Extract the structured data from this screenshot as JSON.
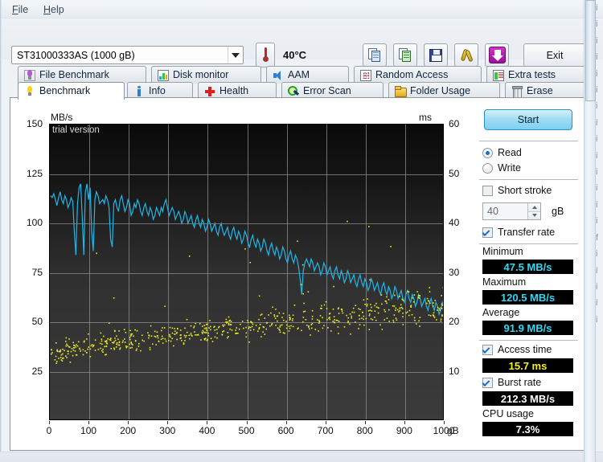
{
  "window": {
    "menu": [
      {
        "name": "file",
        "label": "File",
        "mnemonic": "F"
      },
      {
        "name": "help",
        "label": "Help",
        "mnemonic": "H"
      }
    ]
  },
  "toolbar": {
    "drive_select": {
      "value": "ST31000333AS (1000 gB)",
      "options": [
        "ST31000333AS (1000 gB)"
      ]
    },
    "temperature": "40°C",
    "temperature_icon": "thermometer-icon",
    "buttons": [
      {
        "name": "copy-to-clipboard-button",
        "icon": "copy-page-icon",
        "label": ""
      },
      {
        "name": "copy-image-button",
        "icon": "copy-image-icon",
        "label": ""
      },
      {
        "name": "save-button",
        "icon": "floppy-save-icon",
        "label": ""
      },
      {
        "name": "options-button",
        "icon": "tools-icon",
        "label": ""
      },
      {
        "name": "download-button",
        "icon": "download-arrow-icon",
        "label": ""
      }
    ],
    "exit_label": "Exit"
  },
  "tabs": {
    "row1": [
      {
        "label": "File Benchmark",
        "icon": "bulb-purple-icon",
        "active": false
      },
      {
        "label": "Disk monitor",
        "icon": "bar-chart-icon",
        "active": false
      },
      {
        "label": "AAM",
        "icon": "speaker-icon",
        "active": false
      },
      {
        "label": "Random Access",
        "icon": "scatter-plot-icon",
        "active": false
      },
      {
        "label": "Extra tests",
        "icon": "extra-tests-icon",
        "active": false
      }
    ],
    "row2": [
      {
        "label": "Benchmark",
        "icon": "bulb-yellow-icon",
        "active": true
      },
      {
        "label": "Info",
        "icon": "info-icon",
        "active": false
      },
      {
        "label": "Health",
        "icon": "red-cross-icon",
        "active": false
      },
      {
        "label": "Error Scan",
        "icon": "magnifier-icon",
        "active": false
      },
      {
        "label": "Folder Usage",
        "icon": "folder-icon",
        "active": false
      },
      {
        "label": "Erase",
        "icon": "trash-icon",
        "active": false
      }
    ]
  },
  "controls": {
    "start_label": "Start",
    "mode": {
      "selected": "Read",
      "options": [
        {
          "label": "Read",
          "checked": true
        },
        {
          "label": "Write",
          "checked": false
        }
      ]
    },
    "short_stroke": {
      "label": "Short stroke",
      "checked": false
    },
    "short_stroke_size": {
      "value": "40",
      "unit": "gB"
    },
    "transfer_rate": {
      "label": "Transfer rate",
      "checked": true
    },
    "stats": [
      {
        "label": "Minimum",
        "value": "47.5 MB/s",
        "color": "#35d6ef"
      },
      {
        "label": "Maximum",
        "value": "120.5 MB/s",
        "color": "#35d6ef"
      },
      {
        "label": "Average",
        "value": "91.9 MB/s",
        "color": "#35d6ef"
      }
    ],
    "access_time": {
      "label": "Access time",
      "checked": true,
      "value": "15.7 ms",
      "color": "#f2ef22"
    },
    "burst_rate": {
      "label": "Burst rate",
      "checked": true,
      "value": "212.3 MB/s",
      "color": "#ffffff"
    },
    "cpu_usage": {
      "label": "CPU usage",
      "value": "7.3%",
      "color": "#ffffff"
    }
  },
  "chart_data": {
    "type": "line",
    "title": "",
    "watermark": "trial version",
    "xlabel": "gB",
    "ylabel": "MB/s",
    "y2label": "ms",
    "grid": true,
    "xlim": [
      0,
      1000
    ],
    "ylim": [
      0,
      150
    ],
    "y2lim": [
      0,
      60
    ],
    "xticks": [
      "0",
      "100",
      "200",
      "300",
      "400",
      "500",
      "600",
      "700",
      "800",
      "900",
      "1000"
    ],
    "yticks": [
      "25",
      "50",
      "75",
      "100",
      "125",
      "150"
    ],
    "y2ticks": [
      "10",
      "20",
      "30",
      "40",
      "50",
      "60"
    ],
    "background": "#1d1d1d",
    "series": [
      {
        "name": "Transfer rate",
        "axis": "left",
        "unit": "MB/s",
        "color": "#1fb6e8",
        "x": [
          2,
          6,
          10,
          14,
          18,
          22,
          26,
          30,
          34,
          38,
          42,
          46,
          50,
          54,
          58,
          62,
          66,
          70,
          74,
          78,
          82,
          86,
          90,
          94,
          98,
          102,
          106,
          110,
          114,
          118,
          122,
          126,
          130,
          134,
          138,
          142,
          146,
          150,
          154,
          158,
          162,
          166,
          170,
          174,
          178,
          182,
          186,
          190,
          194,
          198,
          202,
          206,
          210,
          214,
          218,
          222,
          226,
          230,
          234,
          238,
          242,
          246,
          250,
          254,
          258,
          262,
          266,
          270,
          274,
          278,
          282,
          286,
          290,
          294,
          298,
          302,
          306,
          310,
          314,
          318,
          322,
          326,
          330,
          334,
          338,
          342,
          346,
          350,
          354,
          358,
          362,
          366,
          370,
          374,
          378,
          382,
          386,
          390,
          394,
          398,
          402,
          406,
          410,
          414,
          418,
          422,
          426,
          430,
          434,
          438,
          442,
          446,
          450,
          454,
          458,
          462,
          466,
          470,
          474,
          478,
          482,
          486,
          490,
          494,
          498,
          502,
          506,
          510,
          514,
          518,
          522,
          526,
          530,
          534,
          538,
          542,
          546,
          550,
          554,
          558,
          562,
          566,
          570,
          574,
          578,
          582,
          586,
          590,
          594,
          598,
          602,
          606,
          610,
          614,
          618,
          622,
          626,
          630,
          634,
          638,
          642,
          646,
          650,
          654,
          658,
          662,
          666,
          670,
          674,
          678,
          682,
          686,
          690,
          694,
          698,
          702,
          706,
          710,
          714,
          718,
          722,
          726,
          730,
          734,
          738,
          742,
          746,
          750,
          754,
          758,
          762,
          766,
          770,
          774,
          778,
          782,
          786,
          790,
          794,
          798,
          802,
          806,
          810,
          814,
          818,
          822,
          826,
          830,
          834,
          838,
          842,
          846,
          850,
          854,
          858,
          862,
          866,
          870,
          874,
          878,
          882,
          886,
          890,
          894,
          898,
          902,
          906,
          910,
          914,
          918,
          922,
          926,
          930,
          934,
          938,
          942,
          946,
          950,
          954,
          958,
          962,
          966,
          970,
          974,
          978,
          982,
          986,
          990,
          994,
          998
        ],
        "y": [
          114,
          113,
          115,
          112,
          109,
          113,
          116,
          112,
          110,
          114,
          112,
          108,
          110,
          113,
          111,
          96,
          84,
          110,
          118,
          120,
          103,
          84,
          116,
          120,
          112,
          118,
          96,
          86,
          112,
          116,
          114,
          110,
          111,
          112,
          110,
          114,
          112,
          108,
          92,
          88,
          110,
          112,
          108,
          106,
          112,
          114,
          110,
          106,
          108,
          112,
          110,
          104,
          106,
          110,
          108,
          112,
          110,
          106,
          104,
          108,
          110,
          106,
          104,
          108,
          106,
          102,
          104,
          108,
          106,
          104,
          108,
          106,
          110,
          112,
          108,
          104,
          106,
          108,
          106,
          102,
          104,
          106,
          104,
          100,
          102,
          106,
          104,
          100,
          102,
          104,
          100,
          98,
          102,
          104,
          100,
          98,
          102,
          100,
          96,
          98,
          102,
          100,
          96,
          98,
          100,
          96,
          94,
          98,
          100,
          96,
          94,
          96,
          98,
          94,
          92,
          96,
          98,
          94,
          92,
          96,
          94,
          90,
          92,
          96,
          94,
          90,
          88,
          92,
          94,
          90,
          88,
          92,
          90,
          86,
          88,
          92,
          90,
          86,
          84,
          88,
          90,
          86,
          84,
          88,
          86,
          82,
          84,
          88,
          86,
          82,
          80,
          84,
          86,
          82,
          80,
          84,
          82,
          78,
          72,
          64,
          76,
          80,
          82,
          80,
          78,
          82,
          80,
          76,
          78,
          80,
          78,
          74,
          76,
          80,
          78,
          74,
          76,
          78,
          74,
          72,
          76,
          78,
          74,
          72,
          76,
          74,
          70,
          72,
          76,
          74,
          70,
          72,
          74,
          70,
          68,
          72,
          74,
          70,
          68,
          72,
          70,
          66,
          68,
          72,
          70,
          66,
          68,
          70,
          66,
          64,
          68,
          70,
          66,
          64,
          68,
          66,
          62,
          64,
          68,
          66,
          62,
          64,
          66,
          62,
          60,
          64,
          66,
          62,
          60,
          64,
          62,
          58,
          60,
          64,
          62,
          58,
          60,
          62,
          58,
          56,
          60,
          62,
          58,
          56,
          60,
          58,
          54,
          56,
          60,
          58,
          54,
          52,
          56,
          58,
          54,
          52,
          56,
          54,
          50,
          52,
          56,
          54,
          50,
          48,
          52,
          56
        ]
      },
      {
        "name": "Access time",
        "axis": "right",
        "unit": "ms",
        "color": "#ecec20",
        "type": "scatter",
        "note": "scatter cloud rising from ~13 ms near the outer tracks to ~24 ms toward the inner tracks, with sparse outliers up to ~40 ms"
      }
    ]
  },
  "background_page": {
    "edge_lines": [
      "i",
      "i",
      "i",
      "i",
      "i",
      "i",
      "i",
      "i",
      "i",
      "i",
      "i",
      "i",
      "i",
      "i",
      "f",
      "i",
      "i",
      "i",
      "i",
      "i"
    ]
  }
}
